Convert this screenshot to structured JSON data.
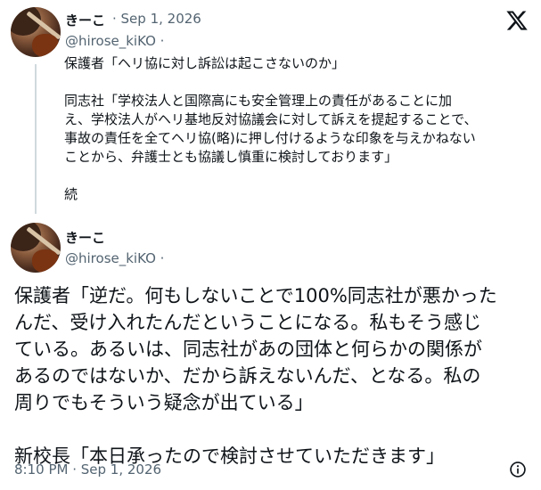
{
  "tweet1": {
    "display_name": "きーこ",
    "date": "· Sep 1, 2026",
    "handle": "@hirose_kiKO ·",
    "lines": [
      "保護者「ヘリ協に対し訴訟は起こさないのか」",
      "同志社「学校法人と国際高にも安全管理上の責任があることに加",
      "え、学校法人がヘリ基地反対協議会に対して訴えを提起することで、",
      "事故の責任を全てヘリ協(略)に押し付けるような印象を与えかねない",
      "ことから、弁護士とも協議し慎重に検討しております」",
      "続"
    ]
  },
  "tweet2": {
    "display_name": "きーこ",
    "handle": "@hirose_kiKO ·",
    "lines": [
      "保護者「逆だ。何もしないことで100%同志社が悪かった",
      "んだ、受け入れたんだということになる。私もそう感じ",
      "ている。あるいは、同志社があの団体と何らかの関係が",
      "あるのではないか、だから訴えないんだ、となる。私の",
      "周りでもそういう疑念が出ている」",
      "新校長「本日承ったので検討させていただきます」"
    ],
    "timestamp": "8:10 PM · Sep 1, 2026"
  },
  "icons": {
    "brand": "x-logo-icon",
    "info": "info-icon"
  },
  "colors": {
    "text": "#0f1419",
    "secondary": "#536471",
    "thread_line": "#cfd9de"
  }
}
